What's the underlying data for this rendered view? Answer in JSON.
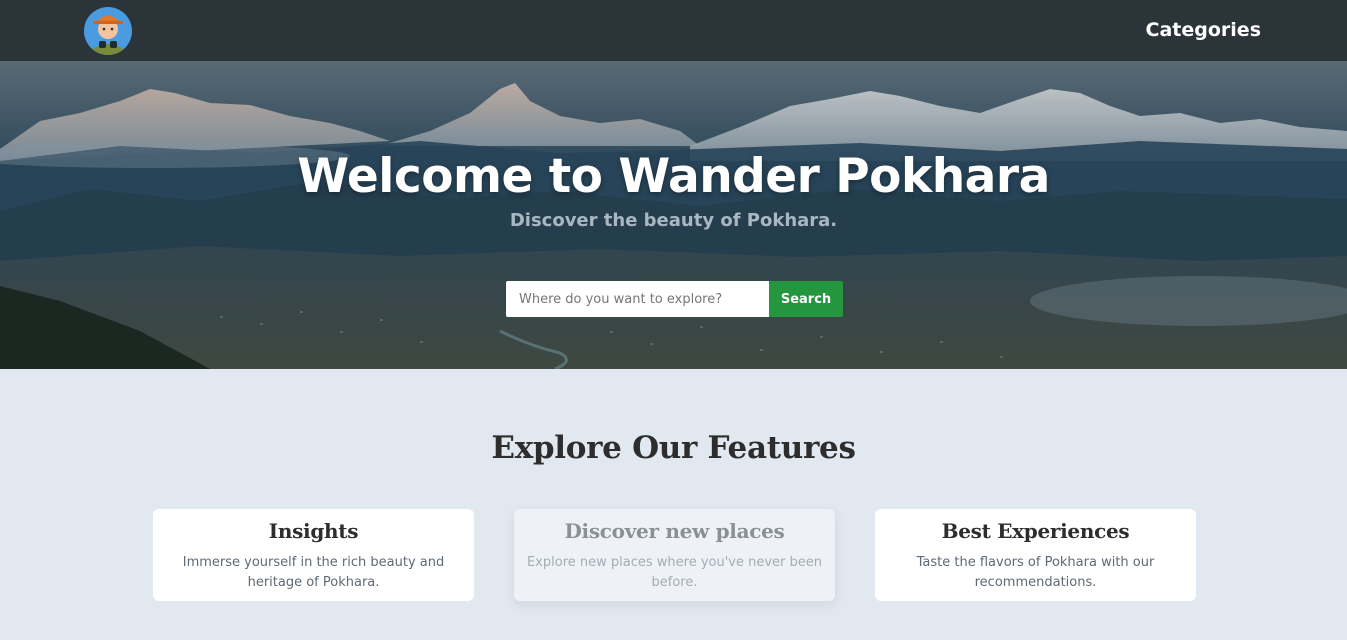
{
  "header": {
    "logo_icon": "explorer-avatar-icon",
    "nav_categories": "Categories"
  },
  "hero": {
    "title": "Welcome to Wander Pokhara",
    "subtitle": "Discover the beauty of Pokhara.",
    "search": {
      "placeholder": "Where do you want to explore?",
      "value": "",
      "button_label": "Search"
    }
  },
  "features": {
    "title": "Explore Our Features",
    "cards": [
      {
        "title": "Insights",
        "text": "Immerse yourself in the rich beauty and heritage of Pokhara."
      },
      {
        "title": "Discover new places",
        "text": "Explore new places where you've never been before."
      },
      {
        "title": "Best Experiences",
        "text": "Taste the flavors of Pokhara with our recommendations."
      }
    ]
  },
  "colors": {
    "navbar": "#2b3439",
    "search_button": "#24963e",
    "page_background": "#e2e8f0"
  }
}
